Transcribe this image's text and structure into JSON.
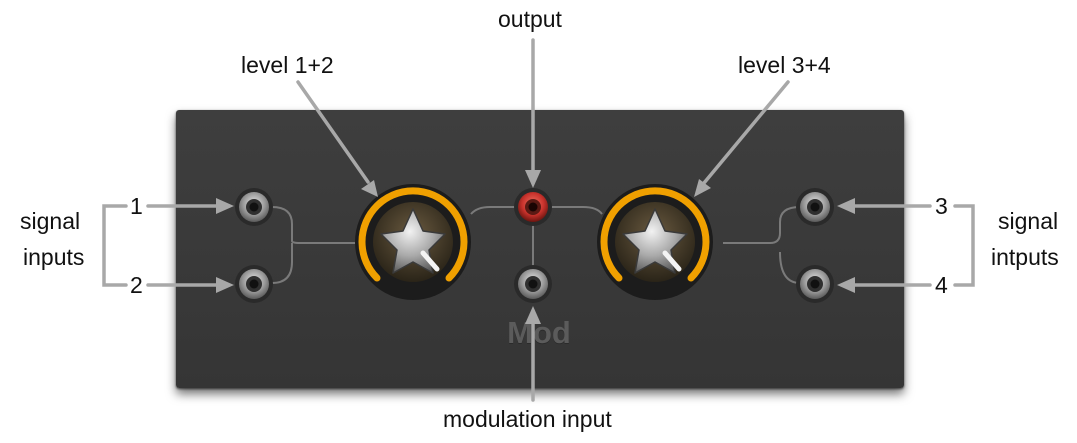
{
  "labels": {
    "output": "output",
    "level_12": "level 1+2",
    "level_34": "level 3+4",
    "modulation_input": "modulation input",
    "signal_left_line1": "signal",
    "signal_left_line2": "inputs",
    "signal_right_line1": "signal",
    "signal_right_line2": "intputs",
    "in1": "1",
    "in2": "2",
    "in3": "3",
    "in4": "4"
  },
  "panel": {
    "mod_label": "Mod"
  },
  "colors": {
    "panel": "#3a3a3a",
    "knob_ring": "#f0a000",
    "output_jack": "#c8322c",
    "arrow": "#a8a8a8",
    "trace": "#7a7a7a"
  },
  "icons": {
    "knob": "knob-icon",
    "jack": "jack-icon"
  }
}
